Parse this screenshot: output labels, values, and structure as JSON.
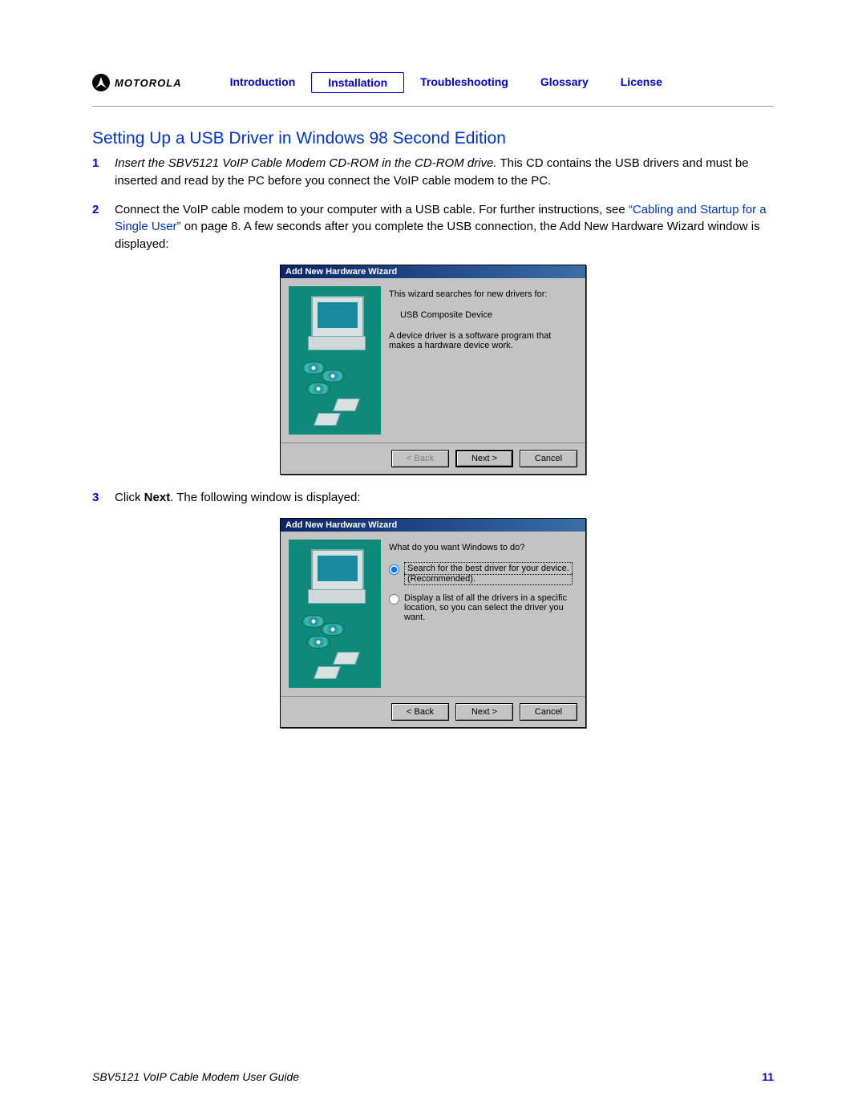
{
  "brand": "MOTOROLA",
  "nav": {
    "items": [
      {
        "label": "Introduction"
      },
      {
        "label": "Installation"
      },
      {
        "label": "Troubleshooting"
      },
      {
        "label": "Glossary"
      },
      {
        "label": "License"
      }
    ],
    "active_index": 1
  },
  "section_title": "Setting Up a USB Driver in Windows 98 Second Edition",
  "steps": {
    "s1": {
      "num": "1",
      "ital": "Insert the SBV5121 VoIP Cable Modem CD-ROM in the CD-ROM drive.",
      "rest": " This CD contains the USB drivers and must be inserted and read by the PC before you connect the VoIP cable modem to the PC."
    },
    "s2": {
      "num": "2",
      "pre": "Connect the VoIP cable modem to your computer with a USB cable. For further instructions, see ",
      "link": "“Cabling and Startup for a Single User”",
      "post": " on page 8. A few seconds after you complete the USB connection, the Add New Hardware Wizard window is displayed:"
    },
    "s3": {
      "num": "3",
      "pre": "Click ",
      "bold": "Next",
      "post": ". The following window is displayed:"
    }
  },
  "wizard1": {
    "title": "Add New Hardware Wizard",
    "line1": "This wizard searches for new drivers for:",
    "line2": "USB Composite Device",
    "line3": "A device driver is a software program that makes a hardware device work.",
    "back": "< Back",
    "next": "Next >",
    "cancel": "Cancel"
  },
  "wizard2": {
    "title": "Add New Hardware Wizard",
    "prompt": "What do you want Windows to do?",
    "opt1a": "Search for the best driver for your device.",
    "opt1b": "(Recommended).",
    "opt2": "Display a list of all the drivers in a specific location, so you can select the driver you want.",
    "back": "< Back",
    "next": "Next >",
    "cancel": "Cancel"
  },
  "footer": {
    "title": "SBV5121 VoIP Cable Modem User Guide",
    "page": "11"
  }
}
